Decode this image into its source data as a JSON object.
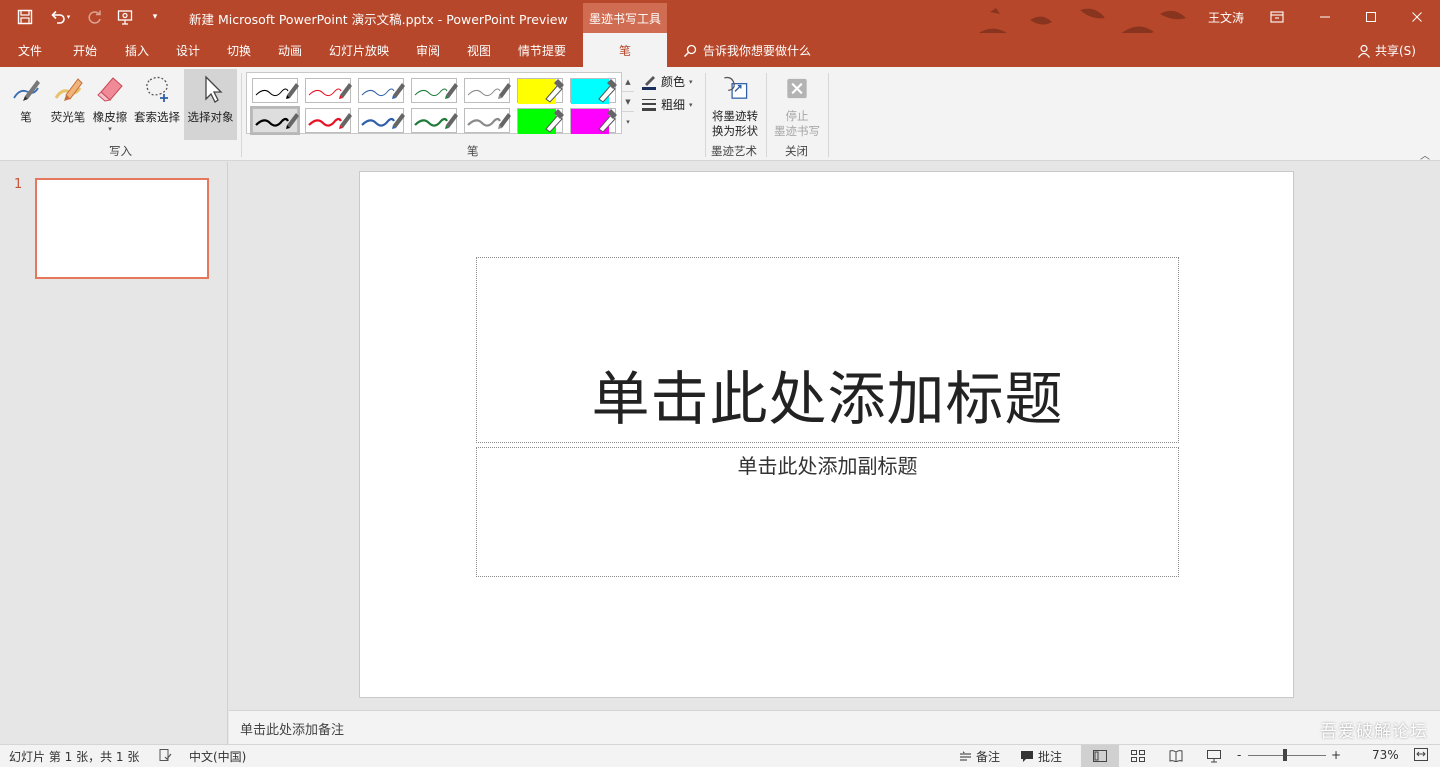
{
  "title_bar": {
    "document_title": "新建 Microsoft PowerPoint 演示文稿.pptx  -  PowerPoint Preview",
    "context_tab": "墨迹书写工具",
    "user_name": "王文涛"
  },
  "tabs": [
    "文件",
    "开始",
    "插入",
    "设计",
    "切换",
    "动画",
    "幻灯片放映",
    "审阅",
    "视图",
    "情节提要",
    "笔"
  ],
  "active_tab": "笔",
  "tell_me": "告诉我你想要做什么",
  "share": "共享(S)",
  "ribbon": {
    "write_group": {
      "label": "写入",
      "buttons": [
        "笔",
        "荧光笔",
        "橡皮擦",
        "套索选择",
        "选择对象"
      ]
    },
    "pens_group": {
      "label": "笔",
      "color_label": "颜色",
      "thickness_label": "粗细"
    },
    "ink_art_group": {
      "label": "墨迹艺术",
      "button_line1": "将墨迹转",
      "button_line2": "换为形状"
    },
    "close_group": {
      "label": "关闭",
      "button_line1": "停止",
      "button_line2": "墨迹书写"
    }
  },
  "pens": [
    {
      "color": "#000000",
      "kind": "thin"
    },
    {
      "color": "#e81123",
      "kind": "thin"
    },
    {
      "color": "#2e5fa8",
      "kind": "thin"
    },
    {
      "color": "#1e7b3a",
      "kind": "thin"
    },
    {
      "color": "#8a8a8a",
      "kind": "thin"
    },
    {
      "color": "#ffff00",
      "kind": "highlighter"
    },
    {
      "color": "#00ffff",
      "kind": "highlighter"
    },
    {
      "color": "#000000",
      "kind": "thick"
    },
    {
      "color": "#e81123",
      "kind": "thick"
    },
    {
      "color": "#2e5fa8",
      "kind": "thick"
    },
    {
      "color": "#1e7b3a",
      "kind": "thick"
    },
    {
      "color": "#8a8a8a",
      "kind": "thick"
    },
    {
      "color": "#00ff00",
      "kind": "highlighter"
    },
    {
      "color": "#ff00ff",
      "kind": "highlighter"
    }
  ],
  "slides": [
    {
      "number": "1"
    }
  ],
  "slide": {
    "title_placeholder": "单击此处添加标题",
    "subtitle_placeholder": "单击此处添加副标题"
  },
  "notes_placeholder": "单击此处添加备注",
  "watermark": "吾爱破解论坛",
  "status_bar": {
    "slide_info": "幻灯片 第 1 张，共 1 张",
    "language": "中文(中国)",
    "notes": "备注",
    "comments": "批注",
    "zoom": "73%",
    "zoom_minus": "-",
    "zoom_plus": "+"
  },
  "colors": {
    "accent": "#b7472a",
    "selected_slide_border": "#e5785c"
  }
}
